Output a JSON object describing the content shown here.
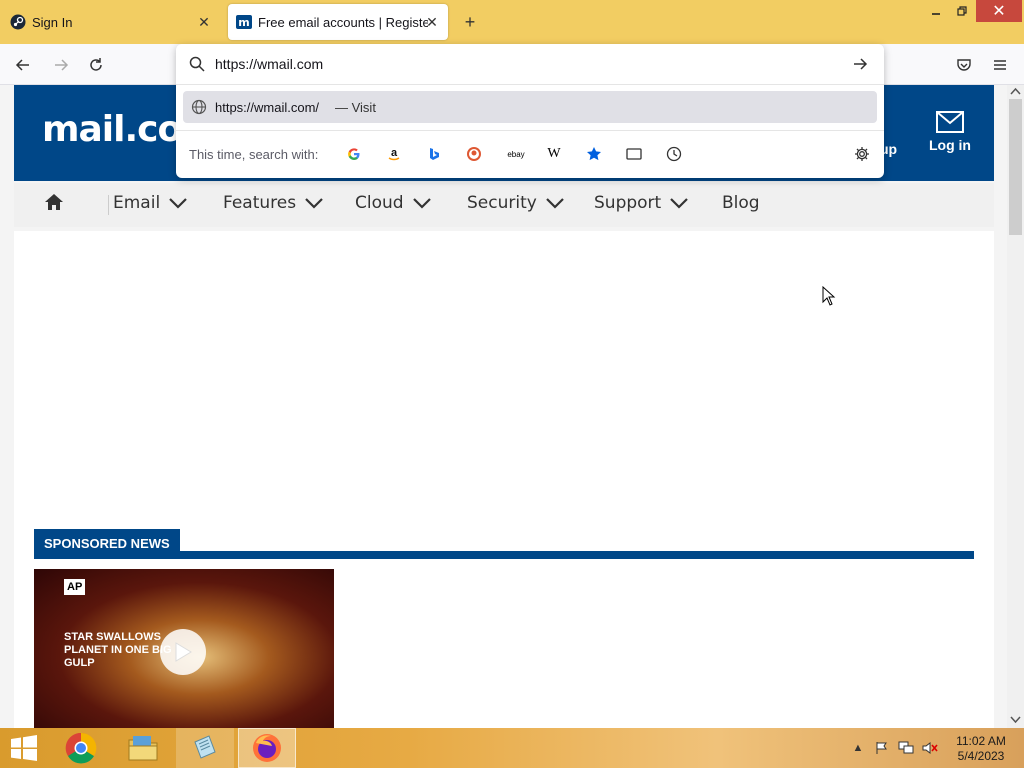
{
  "browser": {
    "tabs": [
      {
        "title": "Sign In",
        "icon": "steam-icon",
        "active": false
      },
      {
        "title": "Free email accounts | Register to",
        "icon": "mail-com-icon",
        "active": true
      }
    ],
    "url_input": "https://wmail.com",
    "suggestion": {
      "url": "https://wmail.com/",
      "action": "— Visit"
    },
    "search_with_label": "This time, search with:",
    "search_engines": [
      "google-icon",
      "amazon-icon",
      "bing-icon",
      "duckduckgo-icon",
      "ebay-icon",
      "wikipedia-icon",
      "bookmarks-icon",
      "tabs-icon",
      "history-icon"
    ],
    "wikipedia_glyph": "W",
    "ebay_glyph": "ebay"
  },
  "site": {
    "logo": "mail.com",
    "signup_fragment": "up",
    "login_label": "Log in",
    "nav": [
      "Email",
      "Features",
      "Cloud",
      "Security",
      "Support",
      "Blog"
    ],
    "sponsored_label": "SPONSORED NEWS",
    "news": {
      "source": "AP",
      "headline": "STAR SWALLOWS PLANET IN ONE BIG GULP"
    }
  },
  "taskbar": {
    "time": "11:02 AM",
    "date": "5/4/2023"
  },
  "colors": {
    "tabbar": "#f2cd62",
    "brand_blue": "#004788",
    "close_red": "#c7483d"
  }
}
